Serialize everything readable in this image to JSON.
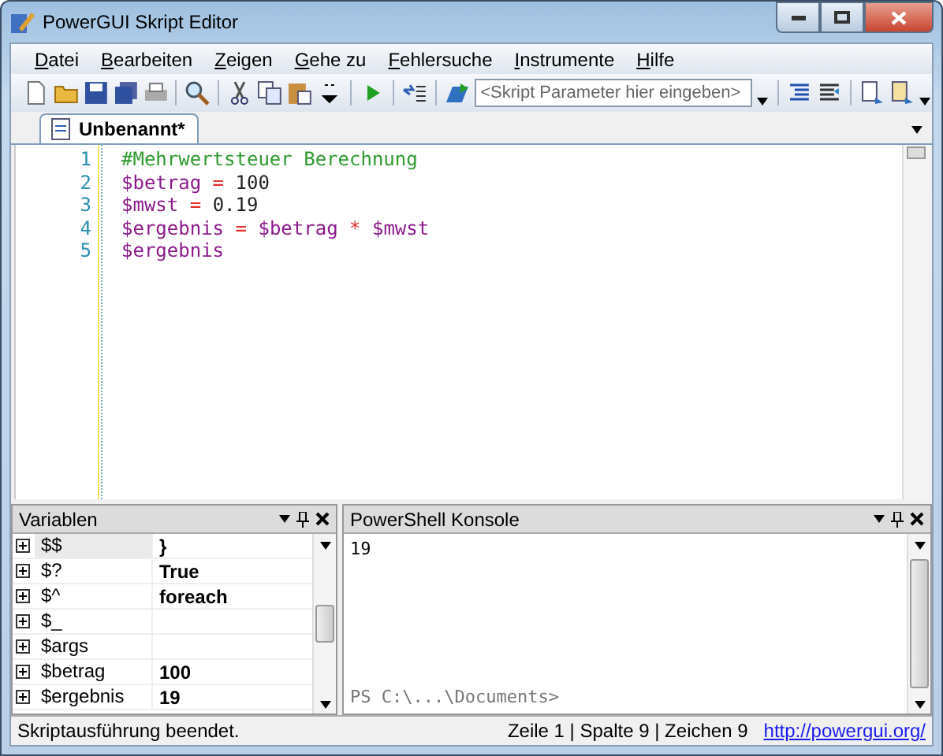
{
  "window": {
    "title": "PowerGUI Skript Editor"
  },
  "menu": [
    "Datei",
    "Bearbeiten",
    "Zeigen",
    "Gehe zu",
    "Fehlersuche",
    "Instrumente",
    "Hilfe"
  ],
  "toolbar": {
    "parameters": {
      "placeholder": "<Skript Parameter hier eingeben>"
    }
  },
  "tabs": [
    {
      "label": "Unbenannt*",
      "selected": true
    }
  ],
  "editor": {
    "lines": [
      {
        "number": "1",
        "tokens": [
          {
            "kind": "comment",
            "text": "#Mehrwertsteuer Berechnung"
          }
        ]
      },
      {
        "number": "2",
        "tokens": [
          {
            "kind": "variable",
            "text": "$betrag"
          },
          {
            "kind": "operator",
            "text": " = "
          },
          {
            "kind": "number",
            "text": "100"
          }
        ]
      },
      {
        "number": "3",
        "tokens": [
          {
            "kind": "variable",
            "text": "$mwst"
          },
          {
            "kind": "operator",
            "text": " = "
          },
          {
            "kind": "number",
            "text": "0.19"
          }
        ]
      },
      {
        "number": "4",
        "tokens": [
          {
            "kind": "variable",
            "text": "$ergebnis"
          },
          {
            "kind": "operator",
            "text": " = "
          },
          {
            "kind": "variable",
            "text": "$betrag"
          },
          {
            "kind": "operator",
            "text": " * "
          },
          {
            "kind": "variable",
            "text": "$mwst"
          }
        ]
      },
      {
        "number": "5",
        "tokens": [
          {
            "kind": "variable",
            "text": "$ergebnis"
          }
        ]
      }
    ]
  },
  "variables_panel": {
    "title": "Variablen",
    "rows": [
      {
        "name": "$$",
        "value": "}"
      },
      {
        "name": "$?",
        "value": "True"
      },
      {
        "name": "$^",
        "value": "foreach"
      },
      {
        "name": "$_"
      },
      {
        "name": "$args"
      },
      {
        "name": "$betrag",
        "value": "100"
      },
      {
        "name": "$ergebnis",
        "value": "19"
      }
    ]
  },
  "console_panel": {
    "title": "PowerShell Konsole",
    "output": "19",
    "prompt": "PS C:\\...\\Documents>"
  },
  "status_bar": {
    "message": "Skriptausführung beendet.",
    "position": "Zeile 1 | Spalte 9 | Zeichen 9",
    "link": "http://powergui.org/"
  }
}
